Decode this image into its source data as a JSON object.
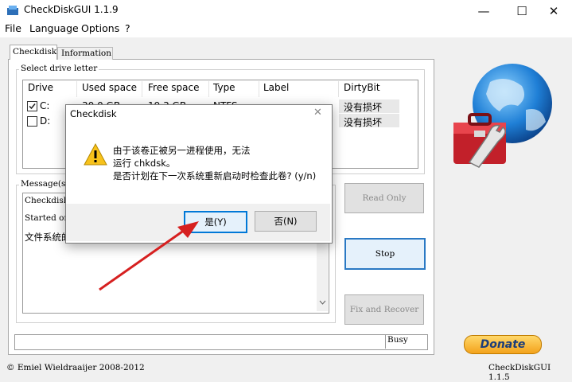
{
  "window": {
    "title": "CheckDiskGUI 1.1.9",
    "minimize": "—",
    "maximize": "☐",
    "close": "✕"
  },
  "menu": [
    "File",
    "Language",
    "Options",
    "?"
  ],
  "tabs": [
    "Checkdisk",
    "Information"
  ],
  "drive_group": {
    "label": "Select drive letter",
    "columns": [
      "Drive",
      "Used space",
      "Free space",
      "Type",
      "Label",
      "DirtyBit"
    ],
    "rows": [
      {
        "checked": true,
        "drive": "C:",
        "used": "30.0 GB",
        "free": "19.3 GB",
        "type": "NTFS",
        "label": "",
        "dirty": "没有损坏"
      },
      {
        "checked": false,
        "drive": "D:",
        "used": "",
        "free": "",
        "type": "",
        "label": "",
        "dirty": "没有损坏"
      }
    ]
  },
  "message_group": {
    "label": "Message(s)",
    "lines": [
      "Checkdisk",
      "Started or",
      "文件系统的"
    ]
  },
  "buttons": {
    "read_only": "Read Only",
    "stop": "Stop",
    "fix_recover": "Fix and Recover"
  },
  "progress": {
    "status": "Busy"
  },
  "footer": {
    "copyright": "© Emiel Wieldraaijer 2008-2012",
    "version": "CheckDiskGUI 1.1.5"
  },
  "donate": "Donate",
  "dialog": {
    "title": "Checkdisk",
    "close": "✕",
    "message_lines": [
      "由于该卷正被另一进程使用，无法",
      "运行 chkdsk。",
      "是否计划在下一次系统重新启动时检查此卷? (y/n)"
    ],
    "yes": "是(Y)",
    "no": "否(N)"
  },
  "colors": {
    "accent": "#0078d7",
    "annotation_arrow": "#d62020"
  }
}
